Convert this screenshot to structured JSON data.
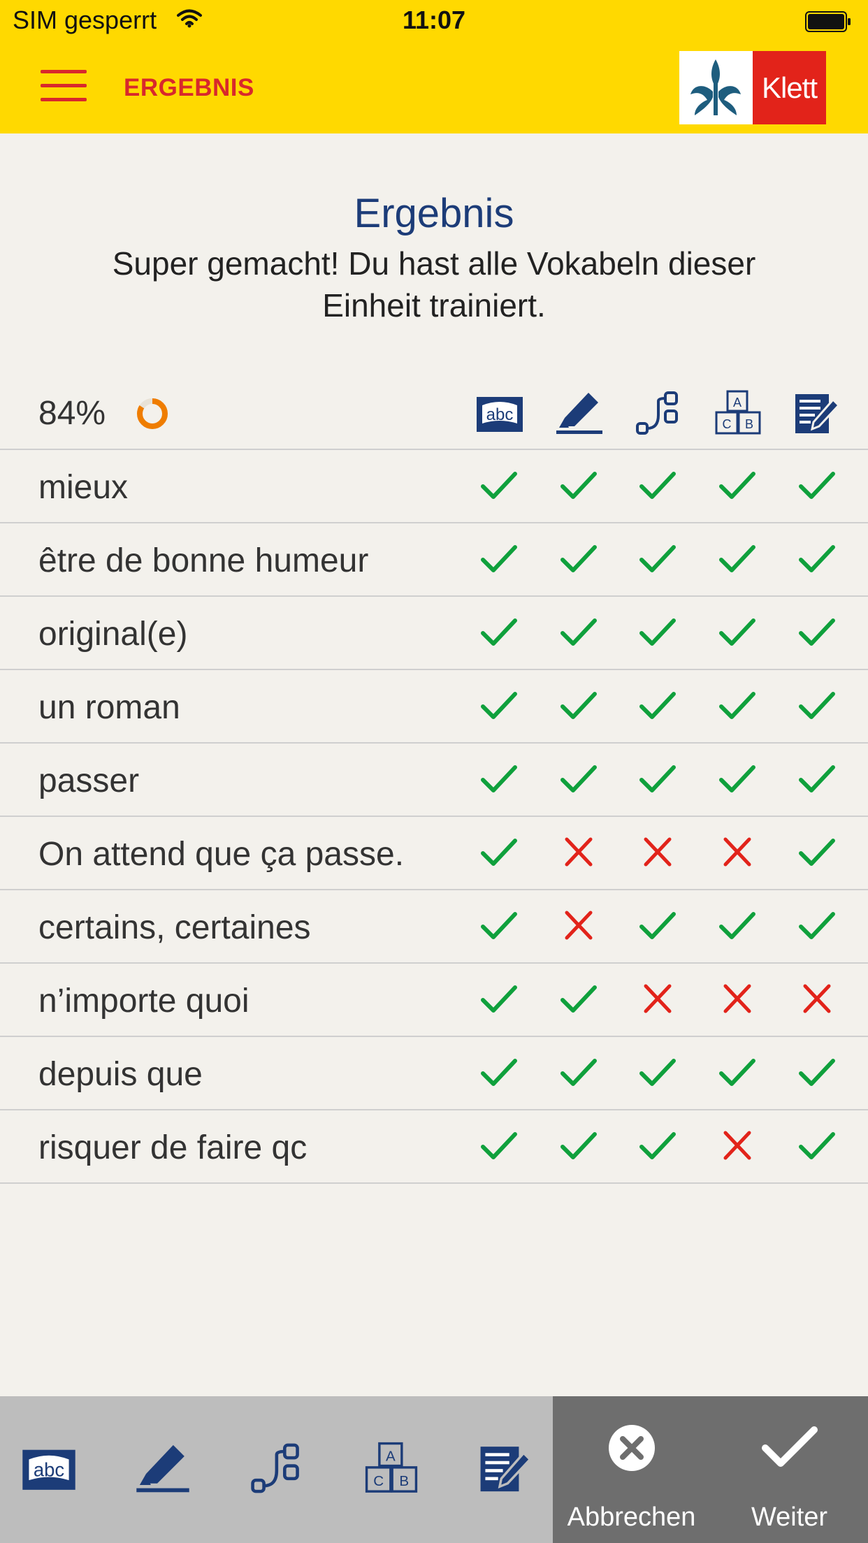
{
  "status_bar": {
    "carrier": "SIM gesperrt",
    "time": "11:07"
  },
  "header": {
    "title": "ERGEBNIS",
    "logo_text": "Klett",
    "accent_color": "#ffd900",
    "brand_red": "#d8282c"
  },
  "result": {
    "title": "Ergebnis",
    "message": "Super gemacht! Du hast alle Vokabeln dieser Einheit trainiert."
  },
  "score": {
    "percent_label": "84%",
    "percent_value": 84
  },
  "columns": [
    "abc-card-icon",
    "marker-icon",
    "connect-icon",
    "letter-blocks-icon",
    "notepad-pen-icon"
  ],
  "vocab": [
    {
      "word": "mieux",
      "results": [
        true,
        true,
        true,
        true,
        true
      ]
    },
    {
      "word": "être de bonne humeur",
      "results": [
        true,
        true,
        true,
        true,
        true
      ]
    },
    {
      "word": "original(e)",
      "results": [
        true,
        true,
        true,
        true,
        true
      ]
    },
    {
      "word": "un roman",
      "results": [
        true,
        true,
        true,
        true,
        true
      ]
    },
    {
      "word": "passer",
      "results": [
        true,
        true,
        true,
        true,
        true
      ]
    },
    {
      "word": "On attend que ça passe.",
      "results": [
        true,
        false,
        false,
        false,
        true
      ]
    },
    {
      "word": "certains, certaines",
      "results": [
        true,
        false,
        true,
        true,
        true
      ]
    },
    {
      "word": "n’importe quoi",
      "results": [
        true,
        true,
        false,
        false,
        false
      ]
    },
    {
      "word": "depuis que",
      "results": [
        true,
        true,
        true,
        true,
        true
      ]
    },
    {
      "word": "risquer de faire qc",
      "results": [
        true,
        true,
        true,
        false,
        true
      ]
    }
  ],
  "bottom_bar": {
    "cancel_label": "Abbrechen",
    "next_label": "Weiter"
  }
}
